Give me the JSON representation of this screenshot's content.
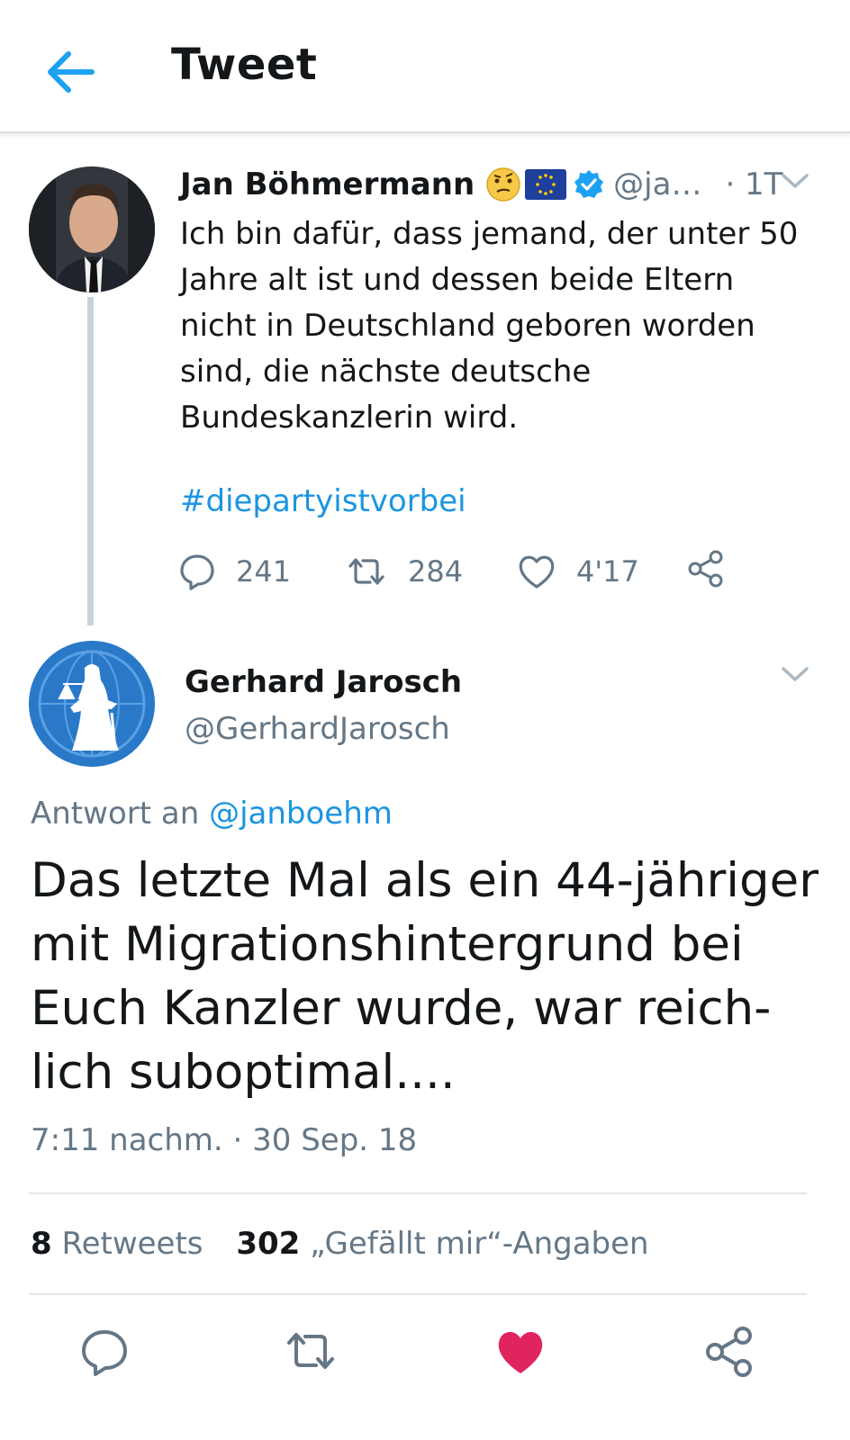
{
  "header": {
    "title": "Tweet",
    "back_icon": "arrow-left-icon",
    "accent": "#1da1f2"
  },
  "parent_tweet": {
    "author_name": "Jan Böhmermann",
    "badges": [
      "face-emoji-icon",
      "eu-flag-icon",
      "verified-icon"
    ],
    "handle": "@ja…",
    "time": "· 1T",
    "text": "Ich bin dafür, dass jemand, der unter 50 Jahre alt ist und dessen beide Eltern nicht in Deutschland geboren worden sind, die nächste deutsche Bundeskanzlerin wird.",
    "hashtag": "#diepartyistvorbei",
    "replies": "241",
    "retweets": "284",
    "likes": "4'17"
  },
  "reply": {
    "author_name": "Gerhard Jarosch",
    "handle": "@GerhardJarosch",
    "reply_to_prefix": "Antwort an",
    "reply_to_handle": "@janboehm",
    "text": "Das letzte Mal als ein 44-jähriger mit Migrationshintergrund bei Euch Kanzler wurde, war reich-lich suboptimal....",
    "timestamp": "7:11 nachm. · 30 Sep. 18",
    "retweet_count": "8",
    "retweet_label": "Retweets",
    "like_count": "302",
    "like_label": "„Gefällt mir“-Angaben",
    "liked": true,
    "like_color": "#e0245e"
  },
  "colors": {
    "link": "#1b95e0",
    "muted": "#657786",
    "text": "#14171a"
  }
}
